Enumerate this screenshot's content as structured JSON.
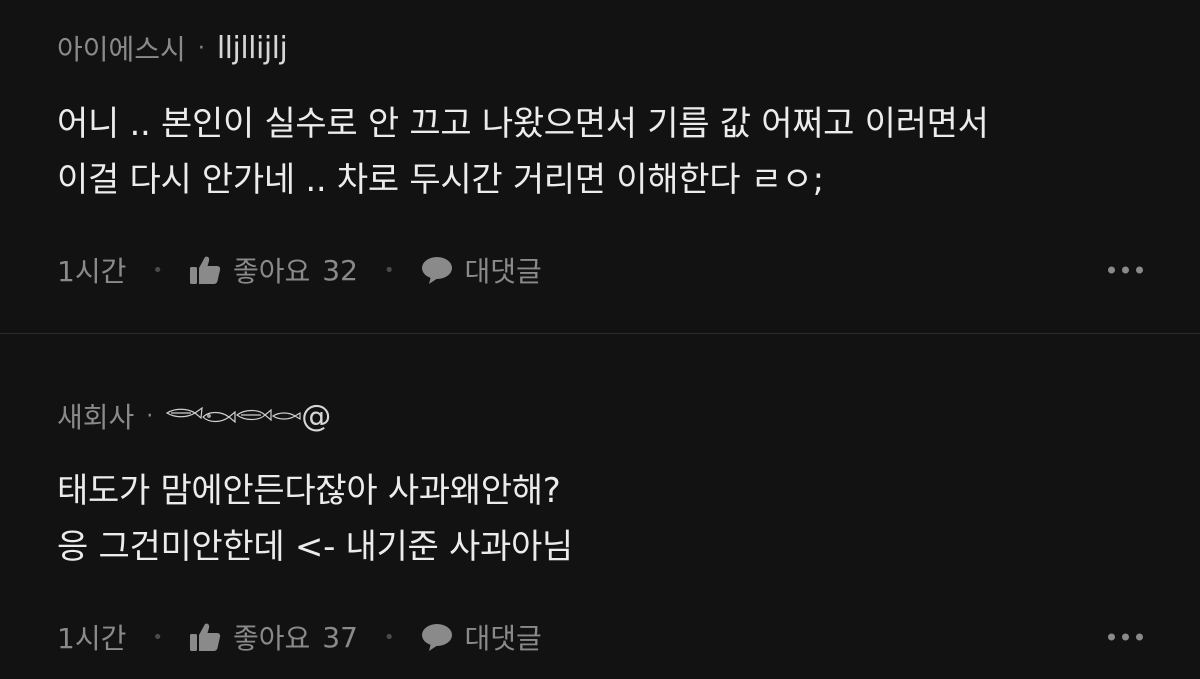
{
  "comments": [
    {
      "nickname": "아이에스시",
      "separator": "·",
      "username": "lljllijlj",
      "lines": [
        "어니 .. 본인이 실수로 안 끄고 나왔으면서 기름 값 어쩌고 이러면서",
        "이걸 다시 안가네 .. 차로 두시간 거리면 이해한다 ㄹㅇ;"
      ],
      "time": "1시간",
      "like_label": "좋아요",
      "like_count": "32",
      "reply_label": "대댓글",
      "icons": {
        "like": "thumbs-up-icon",
        "reply": "speech-bubble-icon",
        "more": "more-dots-icon"
      }
    },
    {
      "nickname": "새회사",
      "separator": "·",
      "username_suffix": "@",
      "lines": [
        "태도가 맘에안든다잖아 사과왜안해?",
        "응 그건미안한데 <- 내기준 사과아님"
      ],
      "time": "1시간",
      "like_label": "좋아요",
      "like_count": "37",
      "reply_label": "대댓글",
      "icons": {
        "like": "thumbs-up-icon",
        "reply": "speech-bubble-icon",
        "more": "more-dots-icon",
        "signature": "fish-doodle-signature"
      }
    }
  ],
  "colors": {
    "background": "#121212",
    "divider": "#2a2a2a",
    "text_primary": "#ececec",
    "text_secondary": "#8a8a8a"
  }
}
